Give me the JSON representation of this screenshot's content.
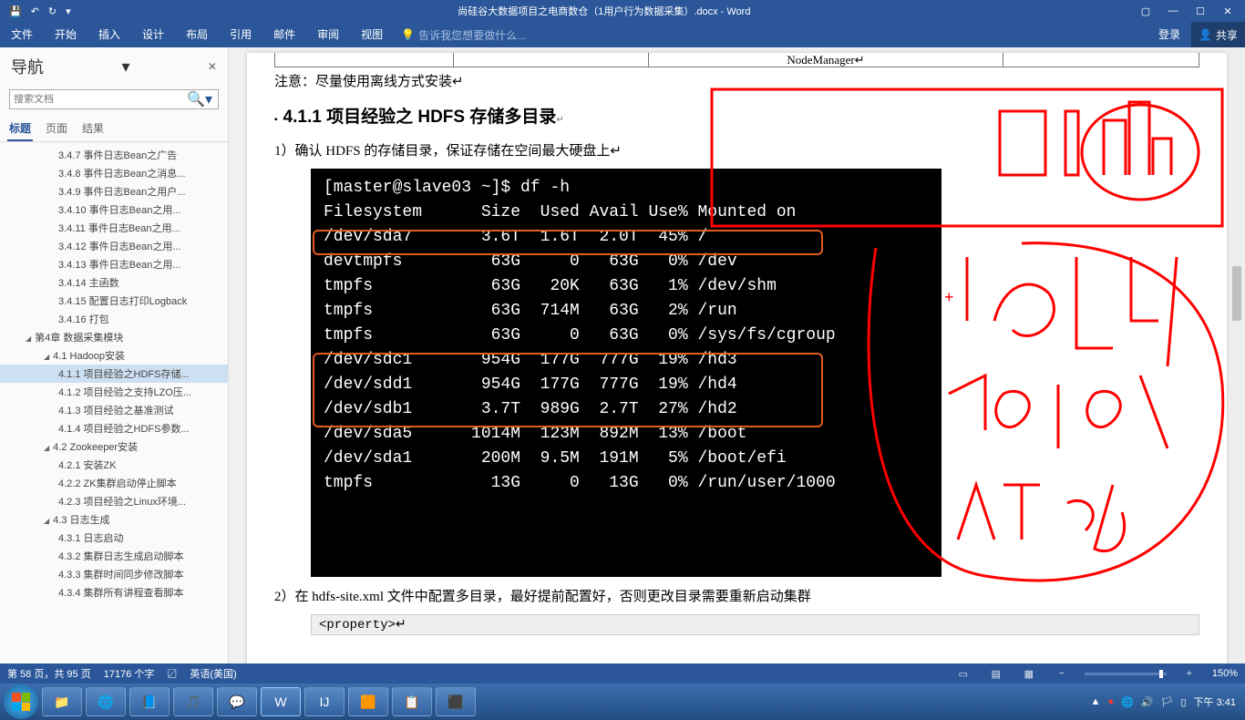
{
  "titlebar": {
    "title": "尚硅谷大数据项目之电商数仓（1用户行为数据采集）.docx - Word"
  },
  "ribbon": {
    "file": "文件",
    "home": "开始",
    "insert": "插入",
    "design": "设计",
    "layout": "布局",
    "ref": "引用",
    "mail": "邮件",
    "review": "审阅",
    "view": "视图",
    "tell": "告诉我您想要做什么...",
    "login": "登录",
    "share": "共享"
  },
  "nav": {
    "title": "导航",
    "search_placeholder": "搜索文档",
    "tab_heading": "标题",
    "tab_page": "页面",
    "tab_result": "结果",
    "items": [
      {
        "t": "3.4.7 事件日志Bean之广告",
        "lv": "lv3"
      },
      {
        "t": "3.4.8 事件日志Bean之消息...",
        "lv": "lv3"
      },
      {
        "t": "3.4.9 事件日志Bean之用户...",
        "lv": "lv3"
      },
      {
        "t": "3.4.10 事件日志Bean之用...",
        "lv": "lv3"
      },
      {
        "t": "3.4.11 事件日志Bean之用...",
        "lv": "lv3"
      },
      {
        "t": "3.4.12 事件日志Bean之用...",
        "lv": "lv3"
      },
      {
        "t": "3.4.13 事件日志Bean之用...",
        "lv": "lv3"
      },
      {
        "t": "3.4.14 主函数",
        "lv": "lv3"
      },
      {
        "t": "3.4.15 配置日志打印Logback",
        "lv": "lv3"
      },
      {
        "t": "3.4.16 打包",
        "lv": "lv3"
      },
      {
        "t": "第4章 数据采集模块",
        "lv": "lv1"
      },
      {
        "t": "4.1 Hadoop安装",
        "lv": "lv2"
      },
      {
        "t": "4.1.1 项目经验之HDFS存储...",
        "lv": "lv3",
        "sel": true
      },
      {
        "t": "4.1.2 项目经验之支持LZO压...",
        "lv": "lv3"
      },
      {
        "t": "4.1.3 项目经验之基准测试",
        "lv": "lv3"
      },
      {
        "t": "4.1.4 项目经验之HDFS参数...",
        "lv": "lv3"
      },
      {
        "t": "4.2 Zookeeper安装",
        "lv": "lv2"
      },
      {
        "t": "4.2.1 安装ZK",
        "lv": "lv3"
      },
      {
        "t": "4.2.2 ZK集群启动停止脚本",
        "lv": "lv3"
      },
      {
        "t": "4.2.3 项目经验之Linux环境...",
        "lv": "lv3"
      },
      {
        "t": "4.3 日志生成",
        "lv": "lv2"
      },
      {
        "t": "4.3.1 日志启动",
        "lv": "lv3"
      },
      {
        "t": "4.3.2 集群日志生成启动脚本",
        "lv": "lv3"
      },
      {
        "t": "4.3.3 集群时间同步修改脚本",
        "lv": "lv3"
      },
      {
        "t": "4.3.4 集群所有讲程查看脚本",
        "lv": "lv3"
      }
    ]
  },
  "doc": {
    "tablecell": "NodeManager↵",
    "note": "注意：尽量使用离线方式安装↵",
    "heading": "4.1.1  项目经验之 HDFS 存储多目录",
    "p1": "1）确认 HDFS 的存储目录，保证存储在空间最大硬盘上↵",
    "terminal_lines": [
      "[master@slave03 ~]$ df -h",
      "Filesystem      Size  Used Avail Use% Mounted on",
      "/dev/sda7       3.6T  1.6T  2.0T  45% /",
      "devtmpfs         63G     0   63G   0% /dev",
      "tmpfs            63G   20K   63G   1% /dev/shm",
      "tmpfs            63G  714M   63G   2% /run",
      "tmpfs            63G     0   63G   0% /sys/fs/cgroup",
      "/dev/sdc1       954G  177G  777G  19% /hd3",
      "/dev/sdd1       954G  177G  777G  19% /hd4",
      "/dev/sdb1       3.7T  989G  2.7T  27% /hd2",
      "/dev/sda5      1014M  123M  892M  13% /boot",
      "/dev/sda1       200M  9.5M  191M   5% /boot/efi",
      "tmpfs            13G     0   13G   0% /run/user/1000"
    ],
    "p2": "2）在 hdfs-site.xml 文件中配置多目录，最好提前配置好，否则更改目录需要重新启动集群",
    "codebox": "<property>↵"
  },
  "status": {
    "page": "第 58 页，共 95 页",
    "words": "17176 个字",
    "lang_mark": "〼",
    "lang": "英语(美国)",
    "zoom": "150%"
  },
  "taskbar": {
    "clock": "下午 3:41"
  }
}
